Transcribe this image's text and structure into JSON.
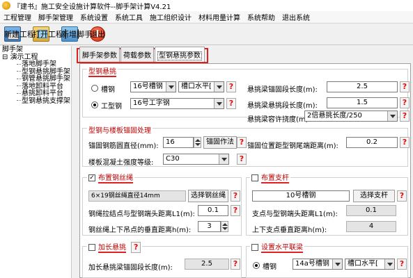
{
  "window": {
    "title": "『建书』施工安全设施计算软件--脚手架计算V4.21"
  },
  "menu": [
    "工程管理",
    "脚手架管理",
    "系统设置",
    "系统工具",
    "施工组织设计",
    "材料用量计算",
    "系统帮助",
    "退出系统"
  ],
  "toolbar": {
    "new": "新建工程",
    "open": "打开工程",
    "add": "新增脚手架",
    "exit": "退出"
  },
  "tree": {
    "root": "脚手架",
    "project": "演示工程",
    "items": [
      "落地脚手架",
      "型钢悬挑脚手架",
      "钢管悬挑脚手架",
      "落地卸料平台",
      "悬挑卸料平台",
      "型钢悬挑支撑架"
    ]
  },
  "tabs": [
    "脚手架参数",
    "荷载参数",
    "型钢悬挑参数"
  ],
  "steel": {
    "title": "型钢悬挑",
    "channel_label": "槽钢",
    "channel_value": "16号槽钢",
    "channel_dir": "槽口水平[",
    "ibeam_label": "工型钢",
    "ibeam_value": "16号工字钢",
    "anchor_len_label": "悬挑梁锚固段长度(m):",
    "anchor_len_value": "2.5",
    "overhang_len_label": "悬挑梁悬挑段长度(m):",
    "overhang_len_value": "1.5",
    "deflection_label": "悬挑梁容许挠度(m):",
    "deflection_value": "2倍悬挑长度/250"
  },
  "anchor": {
    "title": "型钢与楼板锚固处理",
    "bar_dia_label": "锚固钢筋圆直径(mm):",
    "bar_dia_value": "16",
    "method_button": "锚固作法",
    "concrete_label": "楼板混凝土强度等级:",
    "concrete_value": "C30",
    "pos_label": "锚固位置距型钢尾端距离(m):",
    "pos_value": "0.2"
  },
  "rope": {
    "title": "布置钢丝绳",
    "spec_value": "6×19钢丝绳直径14mm",
    "select_button": "选择钢丝绳",
    "dist_label": "钢绳拉结点与型钢端头距离L1(m):",
    "dist_value": "0.1",
    "height_label": "钢丝绳上下吊点的垂直距离h(m):",
    "height_value": "3"
  },
  "support": {
    "title": "布置支杆",
    "spec_value": "10号槽钢",
    "select_button": "选择支杆",
    "dist_label": "支点与型钢端头距离L1(m):",
    "dist_value": "0.1",
    "height_label": "上下支点垂直距离h(m):",
    "height_value": "4"
  },
  "extra": {
    "title": "加长悬挑",
    "len_label": "加长悬挑梁锚固段长度(m):",
    "len_value": "2.5"
  },
  "horiz": {
    "title": "设置水平联梁",
    "channel_label": "槽钢",
    "channel_value": "14a号槽钢",
    "channel_dir": "槽口水平["
  },
  "help": "?",
  "colors": {
    "red": "#e02020",
    "title_red": "#c00000"
  }
}
